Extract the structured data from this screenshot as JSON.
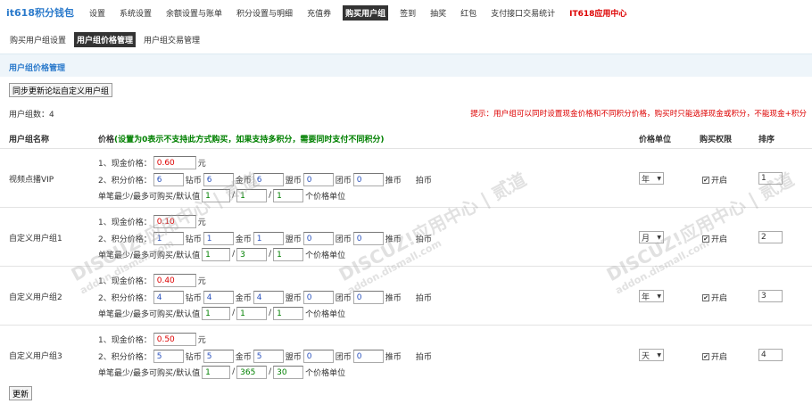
{
  "topnav": {
    "brand": "it618积分钱包",
    "items": [
      {
        "label": "设置"
      },
      {
        "label": "系统设置"
      },
      {
        "label": "余额设置与账单"
      },
      {
        "label": "积分设置与明细"
      },
      {
        "label": "充值券"
      },
      {
        "label": "购买用户组"
      },
      {
        "label": "签到"
      },
      {
        "label": "抽奖"
      },
      {
        "label": "红包"
      },
      {
        "label": "支付接口交易统计"
      },
      {
        "label": "IT618应用中心"
      }
    ]
  },
  "subnav": {
    "items": [
      {
        "label": "购买用户组设置"
      },
      {
        "label": "用户组价格管理"
      },
      {
        "label": "用户组交易管理"
      }
    ]
  },
  "section": {
    "title": "用户组价格管理"
  },
  "sync_button": "同步更新论坛自定义用户组",
  "group_count": "用户组数：4",
  "tip": "提示：用户组可以同时设置现金价格和不同积分价格，购买时只能选择现金或积分，不能现金+积分",
  "table": {
    "headers": {
      "name": "用户组名称",
      "price": "价格",
      "price_note": "(设置为0表示不支持此方式购买，如果支持多积分，需要同时支付不同积分)",
      "unit": "价格单位",
      "perm": "购买权限",
      "sort": "排序"
    },
    "labels": {
      "cash": "1、现金价格：",
      "yuan": "元",
      "points": "2、积分价格：",
      "diamond": "钻币",
      "gold": "金币",
      "league": "盟币",
      "group": "团币",
      "push": "推币",
      "shoot": "拍币",
      "limits": "单笔最少/最多可购买/默认值",
      "limits_unit": "个价格单位",
      "enable": "开启"
    },
    "rows": [
      {
        "name": "视频点播VIP",
        "cash": "0.60",
        "diamond": "6",
        "gold": "6",
        "league": "6",
        "group": "0",
        "push": "0",
        "min": "1",
        "max": "1",
        "default": "1",
        "unit": "年",
        "sort": "1"
      },
      {
        "name": "自定义用户组1",
        "cash": "0.10",
        "diamond": "1",
        "gold": "1",
        "league": "1",
        "group": "0",
        "push": "0",
        "min": "1",
        "max": "3",
        "default": "1",
        "unit": "月",
        "sort": "2"
      },
      {
        "name": "自定义用户组2",
        "cash": "0.40",
        "diamond": "4",
        "gold": "4",
        "league": "4",
        "group": "0",
        "push": "0",
        "min": "1",
        "max": "1",
        "default": "1",
        "unit": "年",
        "sort": "3"
      },
      {
        "name": "自定义用户组3",
        "cash": "0.50",
        "diamond": "5",
        "gold": "5",
        "league": "5",
        "group": "0",
        "push": "0",
        "min": "1",
        "max": "365",
        "default": "30",
        "unit": "天",
        "sort": "4"
      }
    ]
  },
  "update_button": "更新",
  "watermark": {
    "text": "DISCUZ!应用中心 | 贰道",
    "sub": "addon.dismall.com"
  },
  "colors": {
    "brand": "#2b7acb",
    "tip": "#dd0000",
    "note": "#008000",
    "cash_value": "#dd0000",
    "point_value": "#2a52be",
    "limit_value": "#008000"
  }
}
